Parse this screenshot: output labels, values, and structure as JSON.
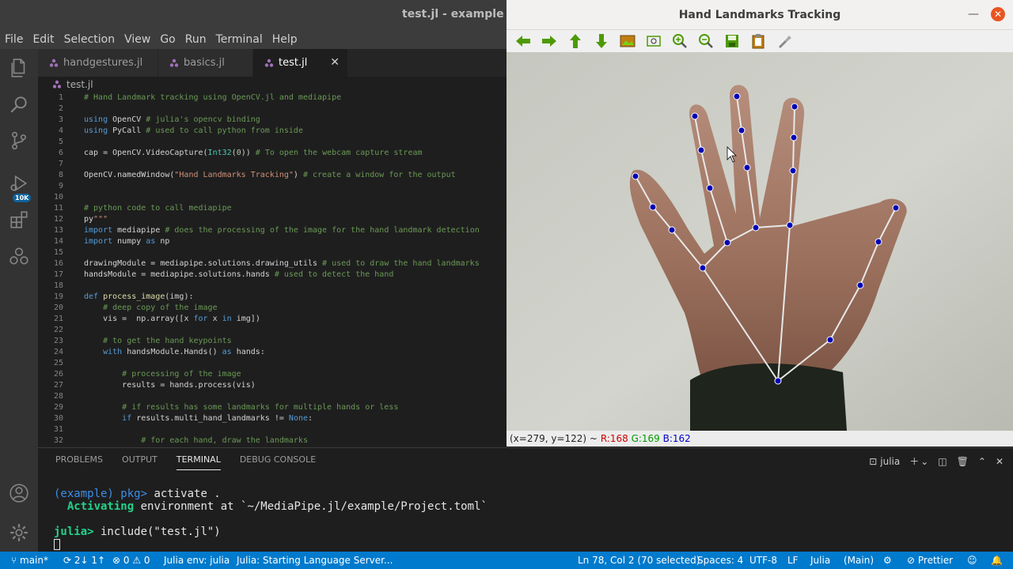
{
  "vscode": {
    "title": "test.jl - example - V",
    "menu": [
      "File",
      "Edit",
      "Selection",
      "View",
      "Go",
      "Run",
      "Terminal",
      "Help"
    ],
    "activity_badge": "10K",
    "tabs": [
      {
        "label": "handgestures.jl",
        "active": false
      },
      {
        "label": "basics.jl",
        "active": false
      },
      {
        "label": "test.jl",
        "active": true
      }
    ],
    "breadcrumb": "test.jl",
    "code_lines": [
      {
        "n": "1",
        "html": "<span class='cm'># Hand Landmark tracking using OpenCV.jl and mediapipe</span>"
      },
      {
        "n": "2",
        "html": ""
      },
      {
        "n": "3",
        "html": "<span class='kw'>using</span> <span class='pl'>OpenCV</span> <span class='cm'># julia's opencv binding</span>"
      },
      {
        "n": "4",
        "html": "<span class='kw'>using</span> <span class='pl'>PyCall</span> <span class='cm'># used to call python from inside</span>"
      },
      {
        "n": "5",
        "html": ""
      },
      {
        "n": "6",
        "html": "<span class='pl'>cap = OpenCV.VideoCapture(</span><span class='ty'>Int32</span><span class='pl'>(</span><span class='nm'>0</span><span class='pl'>))</span> <span class='cm'># To open the webcam capture stream</span>"
      },
      {
        "n": "7",
        "html": ""
      },
      {
        "n": "8",
        "html": "<span class='pl'>OpenCV.namedWindow(</span><span class='st'>\"Hand Landmarks Tracking\"</span><span class='pl'>)</span> <span class='cm'># create a window for the output</span>"
      },
      {
        "n": "9",
        "html": ""
      },
      {
        "n": "10",
        "html": ""
      },
      {
        "n": "11",
        "html": "<span class='cm'># python code to call mediapipe</span>"
      },
      {
        "n": "12",
        "html": "<span class='pl'>py</span><span class='st'>\"\"\"</span>"
      },
      {
        "n": "13",
        "html": "<span class='kw'>import</span> <span class='pl'>mediapipe</span> <span class='cm'># does the processing of the image for the hand landmark detection</span>"
      },
      {
        "n": "14",
        "html": "<span class='kw'>import</span> <span class='pl'>numpy</span> <span class='kw'>as</span> <span class='pl'>np</span>"
      },
      {
        "n": "15",
        "html": ""
      },
      {
        "n": "16",
        "html": "<span class='pl'>drawingModule = mediapipe.solutions.drawing_utils</span> <span class='cm'># used to draw the hand landmarks</span>"
      },
      {
        "n": "17",
        "html": "<span class='pl'>handsModule = mediapipe.solutions.hands</span> <span class='cm'># used to detect the hand</span>"
      },
      {
        "n": "18",
        "html": ""
      },
      {
        "n": "19",
        "html": "<span class='kw'>def</span> <span class='fn'>process_image</span><span class='pl'>(img):</span>"
      },
      {
        "n": "20",
        "html": "    <span class='cm'># deep copy of the image</span>"
      },
      {
        "n": "21",
        "html": "    <span class='pl'>vis =  np.array([x</span> <span class='kw'>for</span> <span class='pl'>x</span> <span class='kw'>in</span> <span class='pl'>img])</span>"
      },
      {
        "n": "22",
        "html": ""
      },
      {
        "n": "23",
        "html": "    <span class='cm'># to get the hand keypoints</span>"
      },
      {
        "n": "24",
        "html": "    <span class='kw'>with</span> <span class='pl'>handsModule.Hands()</span> <span class='kw'>as</span> <span class='pl'>hands:</span>"
      },
      {
        "n": "25",
        "html": ""
      },
      {
        "n": "26",
        "html": "        <span class='cm'># processing of the image</span>"
      },
      {
        "n": "27",
        "html": "        <span class='pl'>results = hands.process(vis)</span>"
      },
      {
        "n": "28",
        "html": ""
      },
      {
        "n": "29",
        "html": "        <span class='cm'># if results has some landmarks for multiple hands or less</span>"
      },
      {
        "n": "30",
        "html": "        <span class='kw'>if</span> <span class='pl'>results.multi_hand_landmarks !=</span> <span class='kw'>None</span><span class='pl'>:</span>"
      },
      {
        "n": "31",
        "html": ""
      },
      {
        "n": "32",
        "html": "            <span class='cm'># for each hand, draw the landmarks</span>"
      }
    ],
    "panel_tabs": [
      {
        "label": "PROBLEMS",
        "active": false
      },
      {
        "label": "OUTPUT",
        "active": false
      },
      {
        "label": "TERMINAL",
        "active": true
      },
      {
        "label": "DEBUG CONSOLE",
        "active": false
      }
    ],
    "terminal_shell": "julia",
    "terminal": {
      "line1_prompt": "(example) pkg>",
      "line1_cmd": " activate .",
      "line2_kw": "  Activating",
      "line2_rest": " environment at `~/MediaPipe.jl/example/Project.toml`",
      "line3_prompt": "julia>",
      "line3_cmd": " include(\"test.jl\")"
    },
    "status": {
      "branch": "main*",
      "sync": "2↓ 1↑",
      "problems": "⊗ 0 ⚠ 0",
      "julia_env": "Julia env: julia",
      "language_server": "Julia: Starting Language Server...",
      "cursor": "Ln 78, Col 2 (70 selected)",
      "spaces": "Spaces: 4",
      "encoding": "UTF-8",
      "eol": "LF",
      "language": "Julia",
      "main": "(Main)",
      "prettier": "Prettier"
    }
  },
  "opencv": {
    "title": "Hand Landmarks Tracking",
    "coords": "(x=279, y=122) ~",
    "r": "R:168",
    "g": "G:169",
    "b": "B:162",
    "toolbar_icons": [
      "arrow-left-icon",
      "arrow-right-icon",
      "arrow-up-icon",
      "arrow-down-icon",
      "image-icon",
      "zoom-fit-icon",
      "zoom-in-icon",
      "zoom-out-icon",
      "save-icon",
      "clipboard-icon",
      "properties-icon"
    ]
  },
  "colors": {
    "accent": "#007acc",
    "landmark": "#0000b4",
    "connection": "#e8e8e8"
  }
}
